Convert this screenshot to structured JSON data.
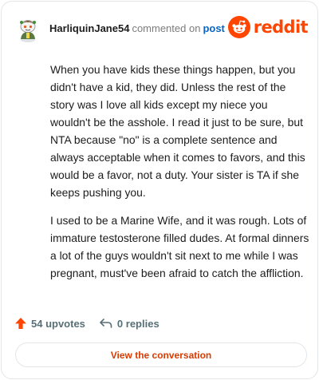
{
  "header": {
    "author": "HarliquinJane54",
    "action": "commented on",
    "post_link": "post",
    "brand": "reddit"
  },
  "comment": {
    "paragraphs": [
      "When you have kids these things happen, but you didn't have a kid, they did. Unless the rest of the story was I love all kids except my niece you wouldn't be the asshole. I read it just to be sure, but NTA because \"no\" is a complete sentence and always acceptable when it comes to favors, and this would be a favor, not a duty. Your sister is TA if she keeps pushing you.",
      "I used to be a Marine Wife, and it was rough. Lots of immature testosterone filled dudes. At formal dinners a lot of the guys wouldn't sit next to me while I was pregnant, must've been afraid to catch the affliction."
    ]
  },
  "footer": {
    "upvotes": "54 upvotes",
    "replies": "0 replies",
    "view_button": "View the conversation"
  },
  "icons": {
    "avatar": "snoo-avatar-icon",
    "brand": "reddit-logo-icon",
    "upvote": "upvote-arrow-icon",
    "reply": "reply-arrow-icon"
  },
  "colors": {
    "brand": "#ff4500",
    "link": "#0a65c2",
    "upvote": "#ff4500",
    "button_text": "#d93a00",
    "muted": "#576f76"
  }
}
